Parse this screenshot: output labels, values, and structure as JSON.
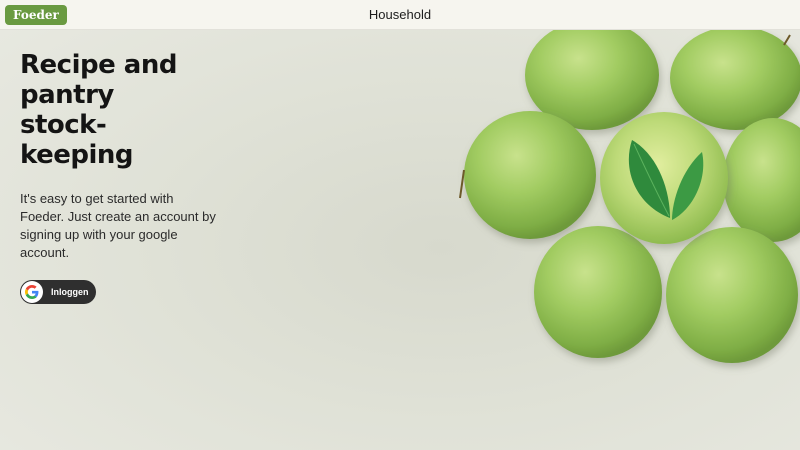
{
  "header": {
    "logo_text": "Foeder",
    "title": "Household"
  },
  "hero": {
    "heading": "Recipe and pantry stock-keeping",
    "description": "It's easy to get started with Foeder. Just create an account by signing up with your google account.",
    "login_button_label": "Inloggen",
    "login_icon": "google-g-icon"
  },
  "image": {
    "subject": "green apples arranged in a flower shape with leaf",
    "icon": "apples-illustration"
  },
  "colors": {
    "brand": "#6a9a41",
    "button_bg": "#2f2f2f",
    "apple_green": "#94c45a"
  }
}
